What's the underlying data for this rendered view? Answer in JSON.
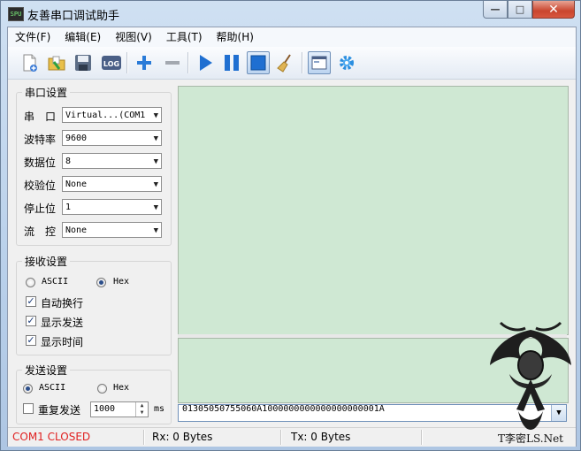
{
  "window": {
    "title": "友善串口调试助手",
    "app_icon_text": "SPU",
    "minimize_glyph": "—",
    "maximize_glyph": "□",
    "close_glyph": "✕"
  },
  "menu": [
    "文件(F)",
    "编辑(E)",
    "视图(V)",
    "工具(T)",
    "帮助(H)"
  ],
  "toolbar": {
    "icons": [
      "new-file-icon",
      "open-folder-icon",
      "save-icon",
      "log-icon",
      "add-icon",
      "remove-icon",
      "play-icon",
      "pause-icon",
      "stop-icon",
      "clear-broom-icon",
      "window-icon",
      "settings-gear-icon"
    ],
    "log_label": "LOG"
  },
  "serial_settings": {
    "title": "串口设置",
    "rows": [
      {
        "label": "串　口",
        "value": "Virtual...(COM1"
      },
      {
        "label": "波特率",
        "value": "9600"
      },
      {
        "label": "数据位",
        "value": "8"
      },
      {
        "label": "校验位",
        "value": "None"
      },
      {
        "label": "停止位",
        "value": "1"
      },
      {
        "label": "流　控",
        "value": "None"
      }
    ]
  },
  "receive_settings": {
    "title": "接收设置",
    "radio_ascii": "ASCII",
    "radio_hex": "Hex",
    "selected": "Hex",
    "checks": [
      {
        "label": "自动换行",
        "checked": true
      },
      {
        "label": "显示发送",
        "checked": true
      },
      {
        "label": "显示时间",
        "checked": true
      }
    ]
  },
  "send_settings": {
    "title": "发送设置",
    "radio_ascii": "ASCII",
    "radio_hex": "Hex",
    "selected": "ASCII",
    "repeat_label": "重复发送",
    "repeat_checked": false,
    "interval_value": "1000",
    "interval_unit": "ms"
  },
  "send_input": {
    "value": "01305050755060A1000000000000000000001A"
  },
  "status": {
    "port_state": "COM1 CLOSED",
    "rx": "Rx: 0 Bytes",
    "tx": "Tx: 0 Bytes",
    "port_state_color": "#e02020"
  },
  "colors": {
    "display_bg": "#cfe8d3",
    "accent_blue": "#1a73c9"
  },
  "watermark_text": "T李密LS.Net"
}
